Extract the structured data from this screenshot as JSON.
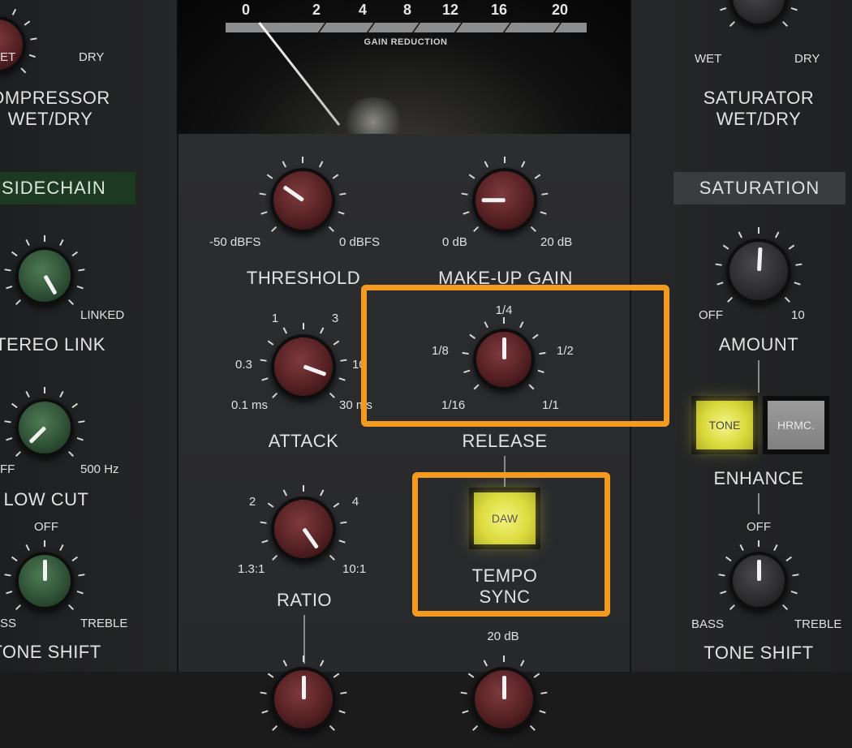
{
  "meter": {
    "scale": [
      "0",
      "2",
      "4",
      "8",
      "12",
      "16",
      "20"
    ],
    "label": "GAIN REDUCTION",
    "needle_value_db": 0
  },
  "left": {
    "wetdry": {
      "left_label": "ET",
      "right_label": "DRY",
      "title_line1": "OMPRESSOR",
      "title_line2": "WET/DRY"
    },
    "sidechain_header": "SIDECHAIN",
    "stereo_link": {
      "right_label": "LINKED",
      "title": "TEREO LINK"
    },
    "low_cut": {
      "left_label": "FF",
      "right_label": "500 Hz",
      "title": "LOW CUT"
    },
    "tone_shift": {
      "top_label": "OFF",
      "left_label": "SS",
      "right_label": "TREBLE",
      "title": "TONE SHIFT"
    }
  },
  "center": {
    "threshold": {
      "min": "-50 dBFS",
      "max": "0 dBFS",
      "title": "THRESHOLD"
    },
    "makeup": {
      "min": "0 dB",
      "max": "20 dB",
      "title": "MAKE-UP GAIN"
    },
    "attack": {
      "t1": "1",
      "t3": "3",
      "t03": "0.3",
      "t10": "10",
      "min": "0.1 ms",
      "max": "30 ms",
      "title": "ATTACK"
    },
    "release": {
      "top": "1/4",
      "left": "1/8",
      "right": "1/2",
      "min": "1/16",
      "max": "1/1",
      "title": "RELEASE"
    },
    "ratio": {
      "t2": "2",
      "t4": "4",
      "min": "1.3:1",
      "max": "10:1",
      "title": "RATIO"
    },
    "tempo_sync": {
      "button": "DAW",
      "title_line1": "TEMPO",
      "title_line2": "SYNC"
    },
    "bottom_label": "20 dB"
  },
  "right": {
    "wetdry": {
      "left_label": "WET",
      "right_label": "DRY",
      "title_line1": "SATURATOR",
      "title_line2": "WET/DRY"
    },
    "saturation_header": "SATURATION",
    "amount": {
      "min": "OFF",
      "max": "10",
      "title": "AMOUNT"
    },
    "enhance": {
      "tone": "TONE",
      "hrmc": "HRMC.",
      "title": "ENHANCE"
    },
    "tone_shift": {
      "top_label": "OFF",
      "left_label": "BASS",
      "right_label": "TREBLE",
      "title": "TONE SHIFT"
    }
  },
  "colors": {
    "highlight": "#f49a1f",
    "button_on": "#e6e550",
    "sidechain": "#1c3a22"
  }
}
